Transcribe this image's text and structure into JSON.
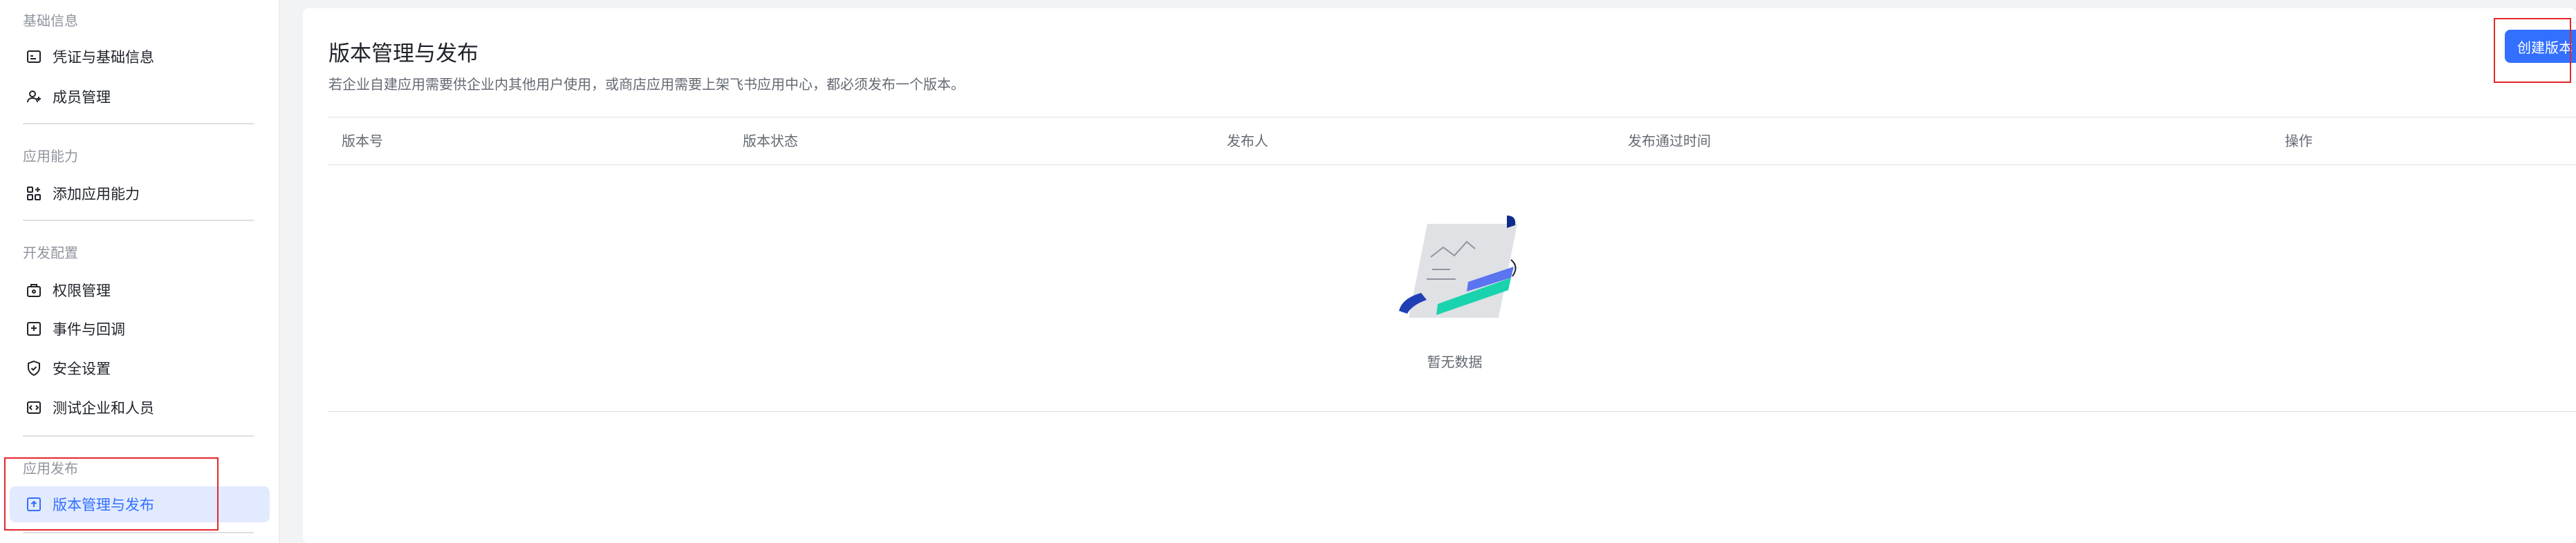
{
  "sidebar": {
    "groups": [
      {
        "title": "基础信息",
        "items": [
          {
            "label": "凭证与基础信息",
            "icon": "credentials-icon"
          },
          {
            "label": "成员管理",
            "icon": "member-icon"
          }
        ]
      },
      {
        "title": "应用能力",
        "items": [
          {
            "label": "添加应用能力",
            "icon": "add-capability-icon"
          }
        ]
      },
      {
        "title": "开发配置",
        "items": [
          {
            "label": "权限管理",
            "icon": "permission-icon"
          },
          {
            "label": "事件与回调",
            "icon": "event-callback-icon"
          },
          {
            "label": "安全设置",
            "icon": "shield-icon"
          },
          {
            "label": "测试企业和人员",
            "icon": "test-org-icon"
          }
        ]
      },
      {
        "title": "应用发布",
        "items": [
          {
            "label": "版本管理与发布",
            "icon": "publish-icon",
            "active": true
          }
        ]
      }
    ]
  },
  "main": {
    "title": "版本管理与发布",
    "description": "若企业自建应用需要供企业内其他用户使用，或商店应用需要上架飞书应用中心，都必须发布一个版本。",
    "create_button": "创建版本",
    "table": {
      "columns": [
        "版本号",
        "版本状态",
        "发布人",
        "发布通过时间",
        "操作"
      ],
      "rows": [],
      "empty_text": "暂无数据"
    }
  },
  "colors": {
    "accent": "#3370ff",
    "active_bg": "#e1eaff",
    "highlight": "#e5262b"
  }
}
